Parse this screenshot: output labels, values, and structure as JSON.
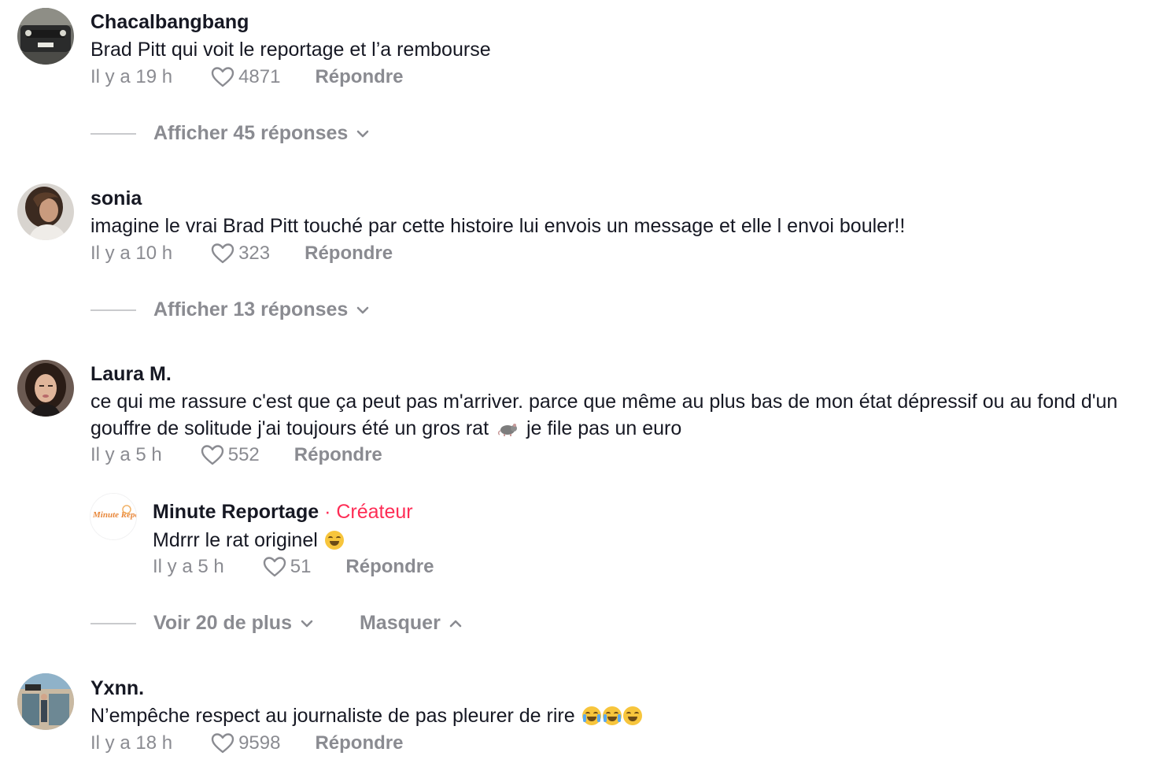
{
  "comments": [
    {
      "username": "Chacalbangbang",
      "text": "Brad Pitt qui voit le reportage et l’a rembourse",
      "time": "Il y a 19 h",
      "likes": "4871",
      "reply_label": "Répondre",
      "replies_toggle": "Afficher 45 réponses"
    },
    {
      "username": "sonia",
      "text": "imagine le vrai Brad Pitt touché par cette histoire lui envois un message et elle l envoi bouler!!",
      "time": "Il y a 10 h",
      "likes": "323",
      "reply_label": "Répondre",
      "replies_toggle": "Afficher 13 réponses"
    },
    {
      "username": "Laura M.",
      "text_line1": "ce qui me rassure c'est que ça peut pas m'arriver. parce que même au plus bas de mon état dépressif ou au fond d'un",
      "text_line2_before": "gouffre de solitude j'ai toujours été un gros rat",
      "text_line2_after": "je file pas un euro",
      "time": "Il y a 5 h",
      "likes": "552",
      "reply_label": "Répondre",
      "reply": {
        "avatar_text": "Minute Reportages",
        "username": "Minute Reportage",
        "creator_tag": "· Créateur",
        "text": "Mdrrr le rat originel",
        "time": "Il y a 5 h",
        "likes": "51",
        "reply_label": "Répondre"
      },
      "more_toggle": "Voir 20 de plus",
      "hide_toggle": "Masquer"
    },
    {
      "username": "Yxnn.",
      "text": "N’empêche respect au journaliste de pas pleurer de rire",
      "time": "Il y a 18 h",
      "likes": "9598",
      "reply_label": "Répondre"
    }
  ],
  "colors": {
    "text": "#161823",
    "muted": "#8a8b91",
    "creator": "#fe2c55"
  }
}
